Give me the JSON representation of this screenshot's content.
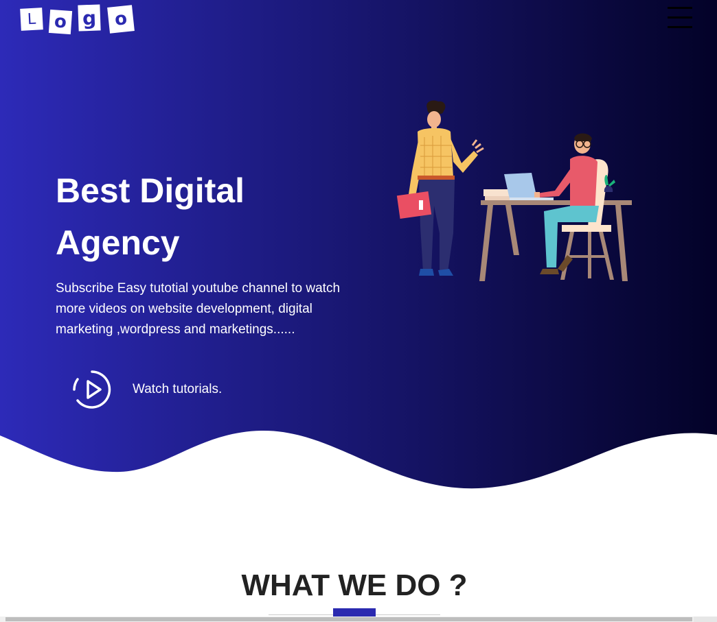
{
  "header": {
    "logo_letters": [
      "L",
      "o",
      "g",
      "o"
    ],
    "menu_icon": "hamburger-menu-icon"
  },
  "hero": {
    "title": "Best Digital Agency",
    "description": "Subscribe Easy tutotial youtube channel to watch more videos on website development, digital marketing ,wordpress and marketings......",
    "cta_label": "Watch tutorials.",
    "cta_icon": "play-circle-icon",
    "illustration": "office-meeting-illustration"
  },
  "section": {
    "title": "WHAT WE DO ?"
  },
  "colors": {
    "gradient_start": "#2d2ab8",
    "gradient_end": "#030228",
    "accent": "#2b2ab0",
    "text_light": "#ffffff",
    "text_dark": "#222222"
  }
}
